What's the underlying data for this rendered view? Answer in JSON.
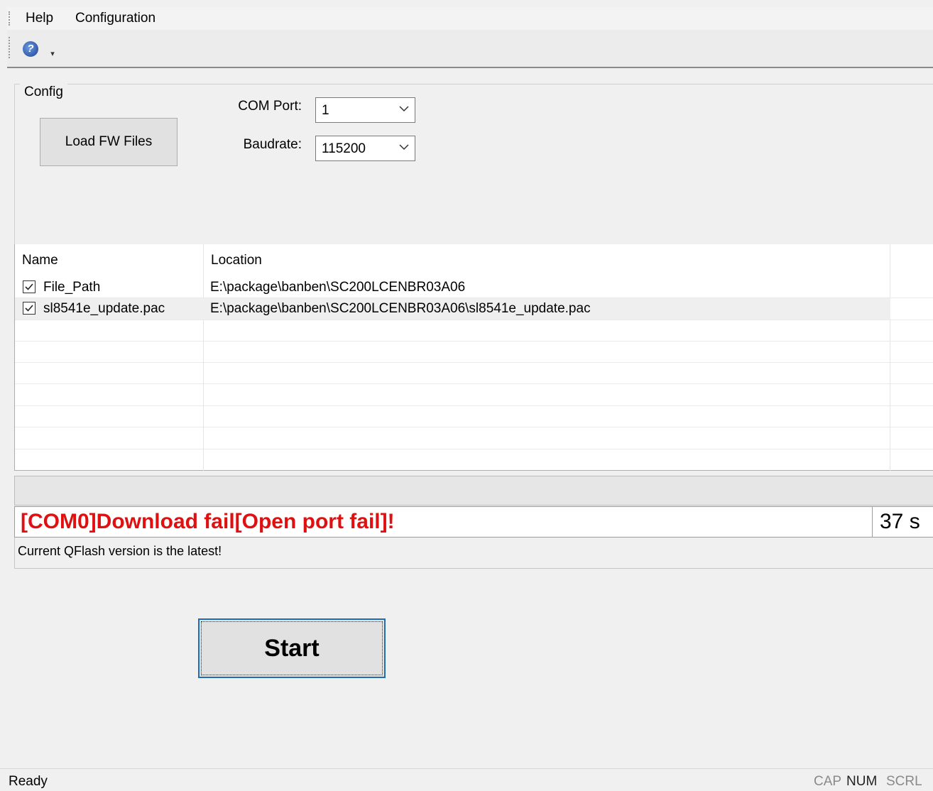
{
  "menu": {
    "help": "Help",
    "configuration": "Configuration"
  },
  "toolbar": {
    "help_icon": "help-icon",
    "overflow_icon": "chevron-down-icon"
  },
  "config": {
    "group_label": "Config",
    "load_button": "Load FW Files",
    "com_port_label": "COM Port:",
    "com_port_value": "1",
    "baudrate_label": "Baudrate:",
    "baudrate_value": "115200"
  },
  "file_list": {
    "columns": [
      "Name",
      "Location"
    ],
    "rows": [
      {
        "checked": true,
        "name": "File_Path",
        "location": "E:\\package\\banben\\SC200LCENBR03A06"
      },
      {
        "checked": true,
        "name": "sl8541e_update.pac",
        "location": "E:\\package\\banben\\SC200LCENBR03A06\\sl8541e_update.pac"
      }
    ]
  },
  "status": {
    "message": "[COM0]Download fail[Open port fail]!",
    "message_color": "#e01010",
    "timer": "37 s"
  },
  "info": "Current QFlash version is the latest!",
  "start_button": "Start",
  "statusbar": {
    "ready": "Ready",
    "cap": "CAP",
    "num": "NUM",
    "scrl": "SCRL"
  }
}
